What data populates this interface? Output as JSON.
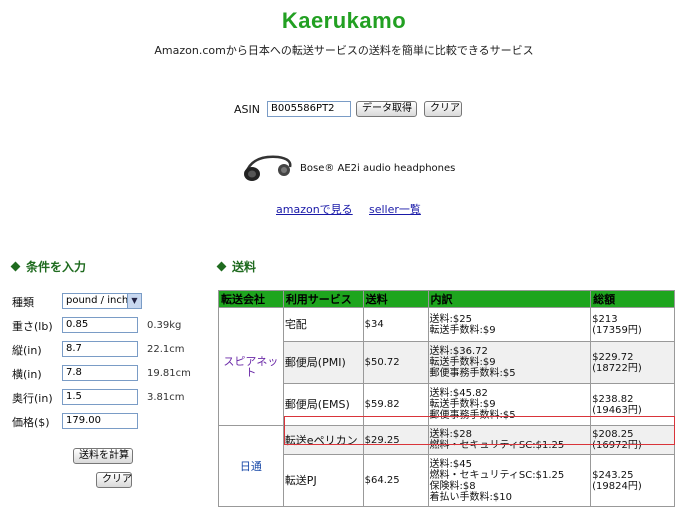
{
  "header": {
    "title": "Kaerukamo",
    "subtitle": "Amazon.comから日本への転送サービスの送料を簡単に比較できるサービス"
  },
  "asin": {
    "label": "ASIN",
    "value": "B005586PT2",
    "fetch_button": "データ取得",
    "clear_button": "クリア"
  },
  "product": {
    "name": "Bose® AE2i audio headphones",
    "amazon_link": "amazonで見る",
    "seller_link": "seller一覧"
  },
  "conditions": {
    "heading": "条件を入力",
    "type_label": "種類",
    "type_value": "pound / inch",
    "weight_label": "重さ(lb)",
    "weight_value": "0.85",
    "weight_conv": "0.39kg",
    "length_label": "縦(in)",
    "length_value": "8.7",
    "length_conv": "22.1cm",
    "width_label": "横(in)",
    "width_value": "7.8",
    "width_conv": "19.81cm",
    "depth_label": "奥行(in)",
    "depth_value": "1.5",
    "depth_conv": "3.81cm",
    "price_label": "価格($)",
    "price_value": "179.00",
    "calc_button": "送料を計算",
    "clear_button": "クリア"
  },
  "shipping": {
    "heading": "送料",
    "columns": [
      "転送会社",
      "利用サービス",
      "送料",
      "内訳",
      "総額"
    ],
    "companies": [
      "スピアネット",
      "日通"
    ],
    "rows": [
      {
        "service": "宅配",
        "fee": "$34",
        "breakdown": [
          "送料:$25",
          "転送手数料:$9"
        ],
        "total": "$213",
        "total_yen": "(17359円)"
      },
      {
        "service": "郵便局(PMI)",
        "fee": "$50.72",
        "breakdown": [
          "送料:$36.72",
          "転送手数料:$9",
          "郵便事務手数料:$5"
        ],
        "total": "$229.72",
        "total_yen": "(18722円)"
      },
      {
        "service": "郵便局(EMS)",
        "fee": "$59.82",
        "breakdown": [
          "送料:$45.82",
          "転送手数料:$9",
          "郵便事務手数料:$5"
        ],
        "total": "$238.82",
        "total_yen": "(19463円)"
      },
      {
        "service": "転送eペリカン",
        "fee": "$29.25",
        "breakdown": [
          "送料:$28",
          "燃料・セキュリティSC:$1.25"
        ],
        "total": "$208.25",
        "total_yen": "(16972円)"
      },
      {
        "service": "転送PJ",
        "fee": "$64.25",
        "breakdown": [
          "送料:$45",
          "燃料・セキュリティSC:$1.25",
          "保険料:$8",
          "着払い手数料:$10"
        ],
        "total": "$243.25",
        "total_yen": "(19824円)"
      }
    ]
  },
  "colors": {
    "title": "#22a022",
    "table_header": "#1ea51e",
    "highlight_border": "#d9343a",
    "link": "#1a1aa8"
  }
}
